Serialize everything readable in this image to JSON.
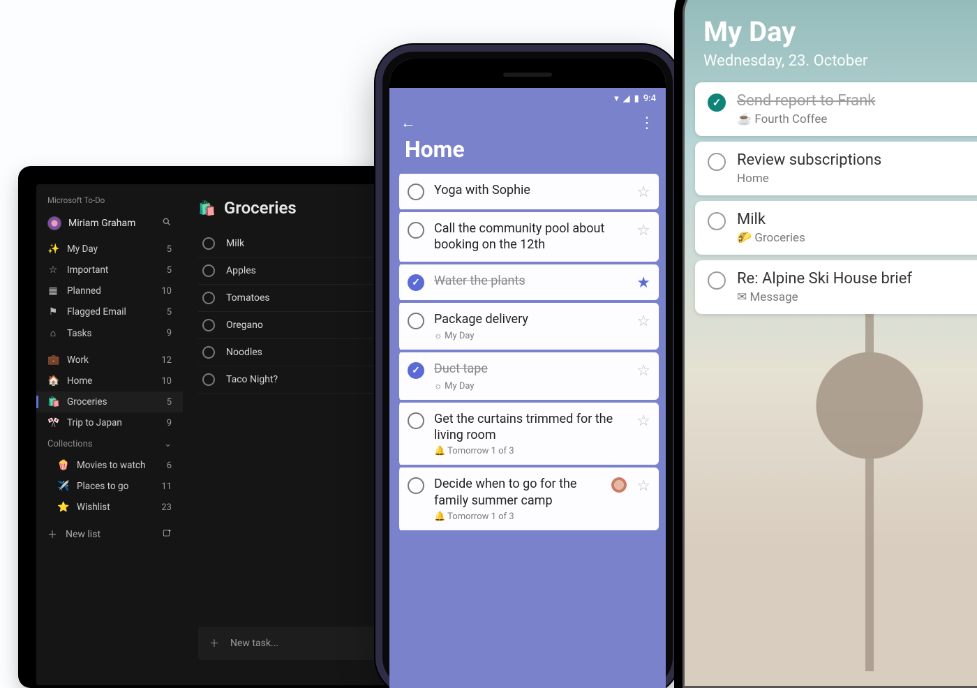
{
  "tablet": {
    "app_title": "Microsoft To-Do",
    "user_name": "Miriam Graham",
    "nav": [
      {
        "icon": "✨",
        "label": "My Day",
        "count": "5"
      },
      {
        "icon": "☆",
        "label": "Important",
        "count": "5"
      },
      {
        "icon": "▦",
        "label": "Planned",
        "count": "10"
      },
      {
        "icon": "⚑",
        "label": "Flagged Email",
        "count": "5"
      },
      {
        "icon": "⌂",
        "label": "Tasks",
        "count": "9"
      }
    ],
    "lists": [
      {
        "icon": "💼",
        "label": "Work",
        "count": "12"
      },
      {
        "icon": "🏠",
        "label": "Home",
        "count": "10"
      },
      {
        "icon": "🛍️",
        "label": "Groceries",
        "count": "5",
        "active": true
      },
      {
        "icon": "🎌",
        "label": "Trip to Japan",
        "count": "9"
      }
    ],
    "collections_label": "Collections",
    "collections": [
      {
        "icon": "🍿",
        "label": "Movies to watch",
        "count": "6"
      },
      {
        "icon": "✈️",
        "label": "Places to go",
        "count": "11"
      },
      {
        "icon": "⭐",
        "label": "Wishlist",
        "count": "23"
      }
    ],
    "new_list_label": "New list",
    "main": {
      "icon": "🛍️",
      "title": "Groceries",
      "tasks": [
        {
          "label": "Milk"
        },
        {
          "label": "Apples"
        },
        {
          "label": "Tomatoes"
        },
        {
          "label": "Oregano"
        },
        {
          "label": "Noodles"
        },
        {
          "label": "Taco Night?"
        }
      ],
      "new_task_placeholder": "New task..."
    }
  },
  "android": {
    "status_time": "9:4",
    "list_title": "Home",
    "tasks": [
      {
        "title": "Yoga with Sophie"
      },
      {
        "title": "Call the community pool about booking on the 12th"
      },
      {
        "title": "Water the plants",
        "done": true,
        "starred": true
      },
      {
        "title": "Package delivery",
        "sub": "☼ My Day"
      },
      {
        "title": "Duct tape",
        "done": true,
        "sub": "☼ My Day"
      },
      {
        "title": "Get the curtains trimmed for the living room",
        "sub": "🔔 Tomorrow  1 of 3"
      },
      {
        "title": "Decide when to go for the family summer camp",
        "sub": "🔔 Tomorrow  1 of 3",
        "avatar": true
      }
    ]
  },
  "iphone": {
    "title": "My Day",
    "date": "Wednesday, 23. October",
    "tasks": [
      {
        "title": "Send report to Frank",
        "done": true,
        "sub": "☕ Fourth Coffee"
      },
      {
        "title": "Review subscriptions",
        "sub": "Home"
      },
      {
        "title": "Milk",
        "sub": "🌮 Groceries"
      },
      {
        "title": "Re: Alpine Ski House brief",
        "sub": "✉ Message"
      }
    ]
  }
}
